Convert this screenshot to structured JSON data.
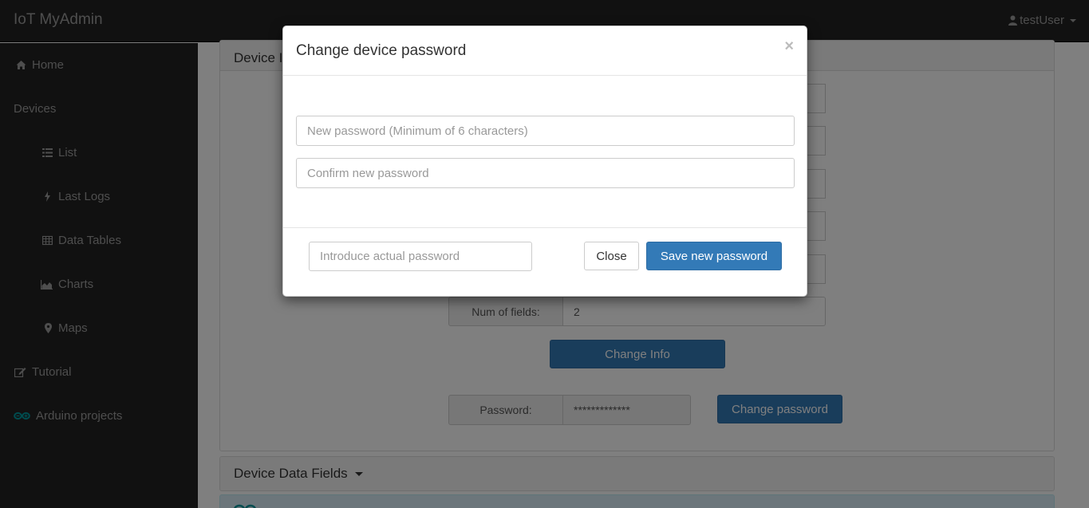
{
  "navbar": {
    "brand": "IoT MyAdmin",
    "user": "testUser"
  },
  "sidebar": {
    "items": [
      {
        "label": "Home",
        "icon": "home-icon"
      },
      {
        "label": "Devices",
        "icon": ""
      },
      {
        "label": "List",
        "icon": "list-icon"
      },
      {
        "label": "Last Logs",
        "icon": "flash-icon"
      },
      {
        "label": "Data Tables",
        "icon": "table-icon"
      },
      {
        "label": "Charts",
        "icon": "area-chart-icon"
      },
      {
        "label": "Maps",
        "icon": "map-marker-icon"
      },
      {
        "label": "Tutorial",
        "icon": "edit-icon"
      },
      {
        "label": "Arduino projects",
        "icon": "arduino-icon"
      }
    ]
  },
  "device_info_panel": {
    "heading": "Device I",
    "num_fields_label": "Num of fields:",
    "num_fields_value": "2",
    "change_info_label": "Change Info",
    "password_label": "Password:",
    "password_value": "*************",
    "change_password_label": "Change password"
  },
  "data_fields_panel": {
    "heading": "Device Data Fields"
  },
  "modal": {
    "title": "Change device password",
    "close_symbol": "×",
    "new_password_placeholder": "New password (Minimum of 6 characters)",
    "confirm_password_placeholder": "Confirm new password",
    "actual_password_placeholder": "Introduce actual password",
    "close_label": "Close",
    "save_label": "Save new password"
  },
  "colors": {
    "navbar": "#222222",
    "primary": "#337ab7",
    "arduino_accent": "#00979c"
  }
}
